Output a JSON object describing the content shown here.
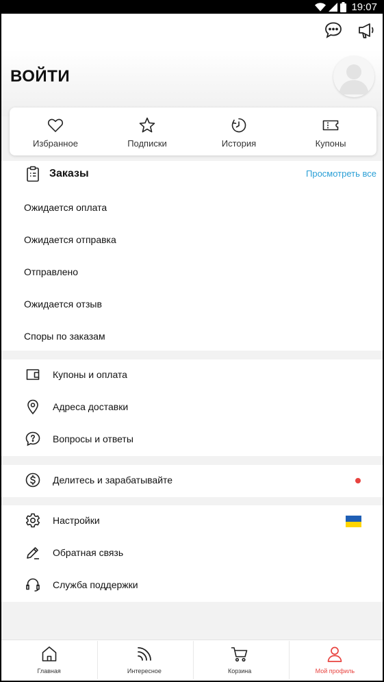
{
  "status_bar": {
    "time": "19:07"
  },
  "header": {
    "login_title": "ВОЙТИ"
  },
  "quick_links": [
    {
      "icon": "heart-icon",
      "label": "Избранное"
    },
    {
      "icon": "star-icon",
      "label": "Подписки"
    },
    {
      "icon": "history-clock-icon",
      "label": "История"
    },
    {
      "icon": "ticket-icon",
      "label": "Купоны"
    }
  ],
  "orders": {
    "title": "Заказы",
    "view_all": "Просмотреть все",
    "statuses": [
      "Ожидается оплата",
      "Ожидается отправка",
      "Отправлено",
      "Ожидается отзыв",
      "Споры по заказам"
    ]
  },
  "menu": {
    "coupons_payment": "Купоны и оплата",
    "delivery_addresses": "Адреса доставки",
    "qa": "Вопросы и ответы",
    "share_earn": "Делитесь и зарабатывайте",
    "settings": "Настройки",
    "feedback": "Обратная связь",
    "support": "Служба поддержки"
  },
  "colors": {
    "accent_red": "#e8433f",
    "link_blue": "#2a9fd6",
    "flag_blue": "#1f5fb5",
    "flag_yellow": "#ffd500"
  },
  "bottom_nav": [
    {
      "icon": "home-icon",
      "label": "Главная",
      "active": false
    },
    {
      "icon": "feed-icon",
      "label": "Интересное",
      "active": false
    },
    {
      "icon": "cart-icon",
      "label": "Корзина",
      "active": false
    },
    {
      "icon": "profile-icon",
      "label": "Мой профиль",
      "active": true
    }
  ]
}
